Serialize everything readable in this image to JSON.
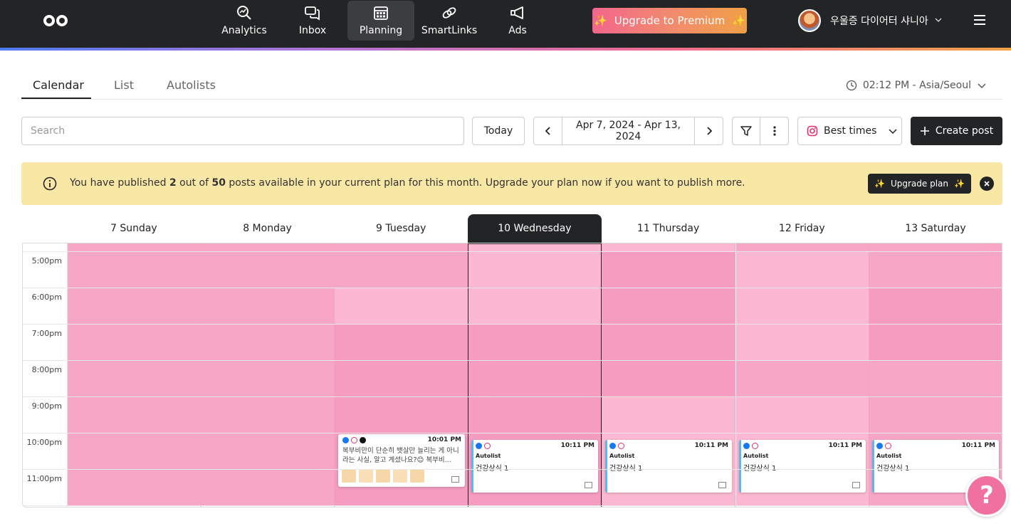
{
  "nav": {
    "items": [
      {
        "label": "Analytics",
        "icon": "analytics-icon"
      },
      {
        "label": "Inbox",
        "icon": "inbox-icon"
      },
      {
        "label": "Planning",
        "icon": "calendar-icon",
        "active": true
      },
      {
        "label": "SmartLinks",
        "icon": "link-icon"
      },
      {
        "label": "Ads",
        "icon": "megaphone-icon"
      }
    ],
    "premium_label": "Upgrade to Premium",
    "username": "우울증 다이어터 샤니아"
  },
  "tabs": [
    "Calendar",
    "List",
    "Autolists"
  ],
  "timezone": "02:12 PM - Asia/Seoul",
  "toolbar": {
    "search_placeholder": "Search",
    "today_label": "Today",
    "date_range": "Apr 7, 2024 - Apr 13, 2024",
    "best_times_label": "Best times",
    "create_post_label": "Create post"
  },
  "banner": {
    "text_before": "You have published ",
    "published": "2",
    "text_mid": " out of ",
    "total": "50",
    "text_after": " posts available in your current plan for this month. Upgrade your plan now if you want to publish more.",
    "upgrade_label": "Upgrade plan"
  },
  "days": [
    "7 Sunday",
    "8 Monday",
    "9 Tuesday",
    "10 Wednesday",
    "11 Thursday",
    "12 Friday",
    "13 Saturday"
  ],
  "times": [
    "5:00pm",
    "6:00pm",
    "7:00pm",
    "8:00pm",
    "9:00pm",
    "10:00pm",
    "11:00pm"
  ],
  "posts": [
    {
      "day": "9 Tuesday",
      "time": "10:01 PM",
      "caption": "복부비만이 단순히 뱃살만 늘리는 게 아니라는 사실, 알고 계셨나요?😊 복부비...",
      "platforms": [
        "facebook",
        "instagram",
        "tiktok"
      ]
    },
    {
      "day": "10 Wednesday",
      "time": "10:11 PM",
      "autolist": "Autolist",
      "caption": "건강상식 1",
      "platforms": [
        "facebook",
        "instagram"
      ]
    },
    {
      "day": "11 Thursday",
      "time": "10:11 PM",
      "autolist": "Autolist",
      "caption": "건강상식 1",
      "platforms": [
        "facebook",
        "instagram"
      ]
    },
    {
      "day": "12 Friday",
      "time": "10:11 PM",
      "autolist": "Autolist",
      "caption": "건강상식 1",
      "platforms": [
        "facebook",
        "instagram"
      ]
    },
    {
      "day": "13 Saturday",
      "time": "10:11 PM",
      "autolist": "Autolist",
      "caption": "건강상식 1",
      "platforms": [
        "facebook",
        "instagram"
      ]
    }
  ],
  "colors": {
    "dark": "#222426",
    "banner": "#f9e7a6",
    "pink_cell": "#f8a6c6",
    "accent": "#f070a0"
  }
}
